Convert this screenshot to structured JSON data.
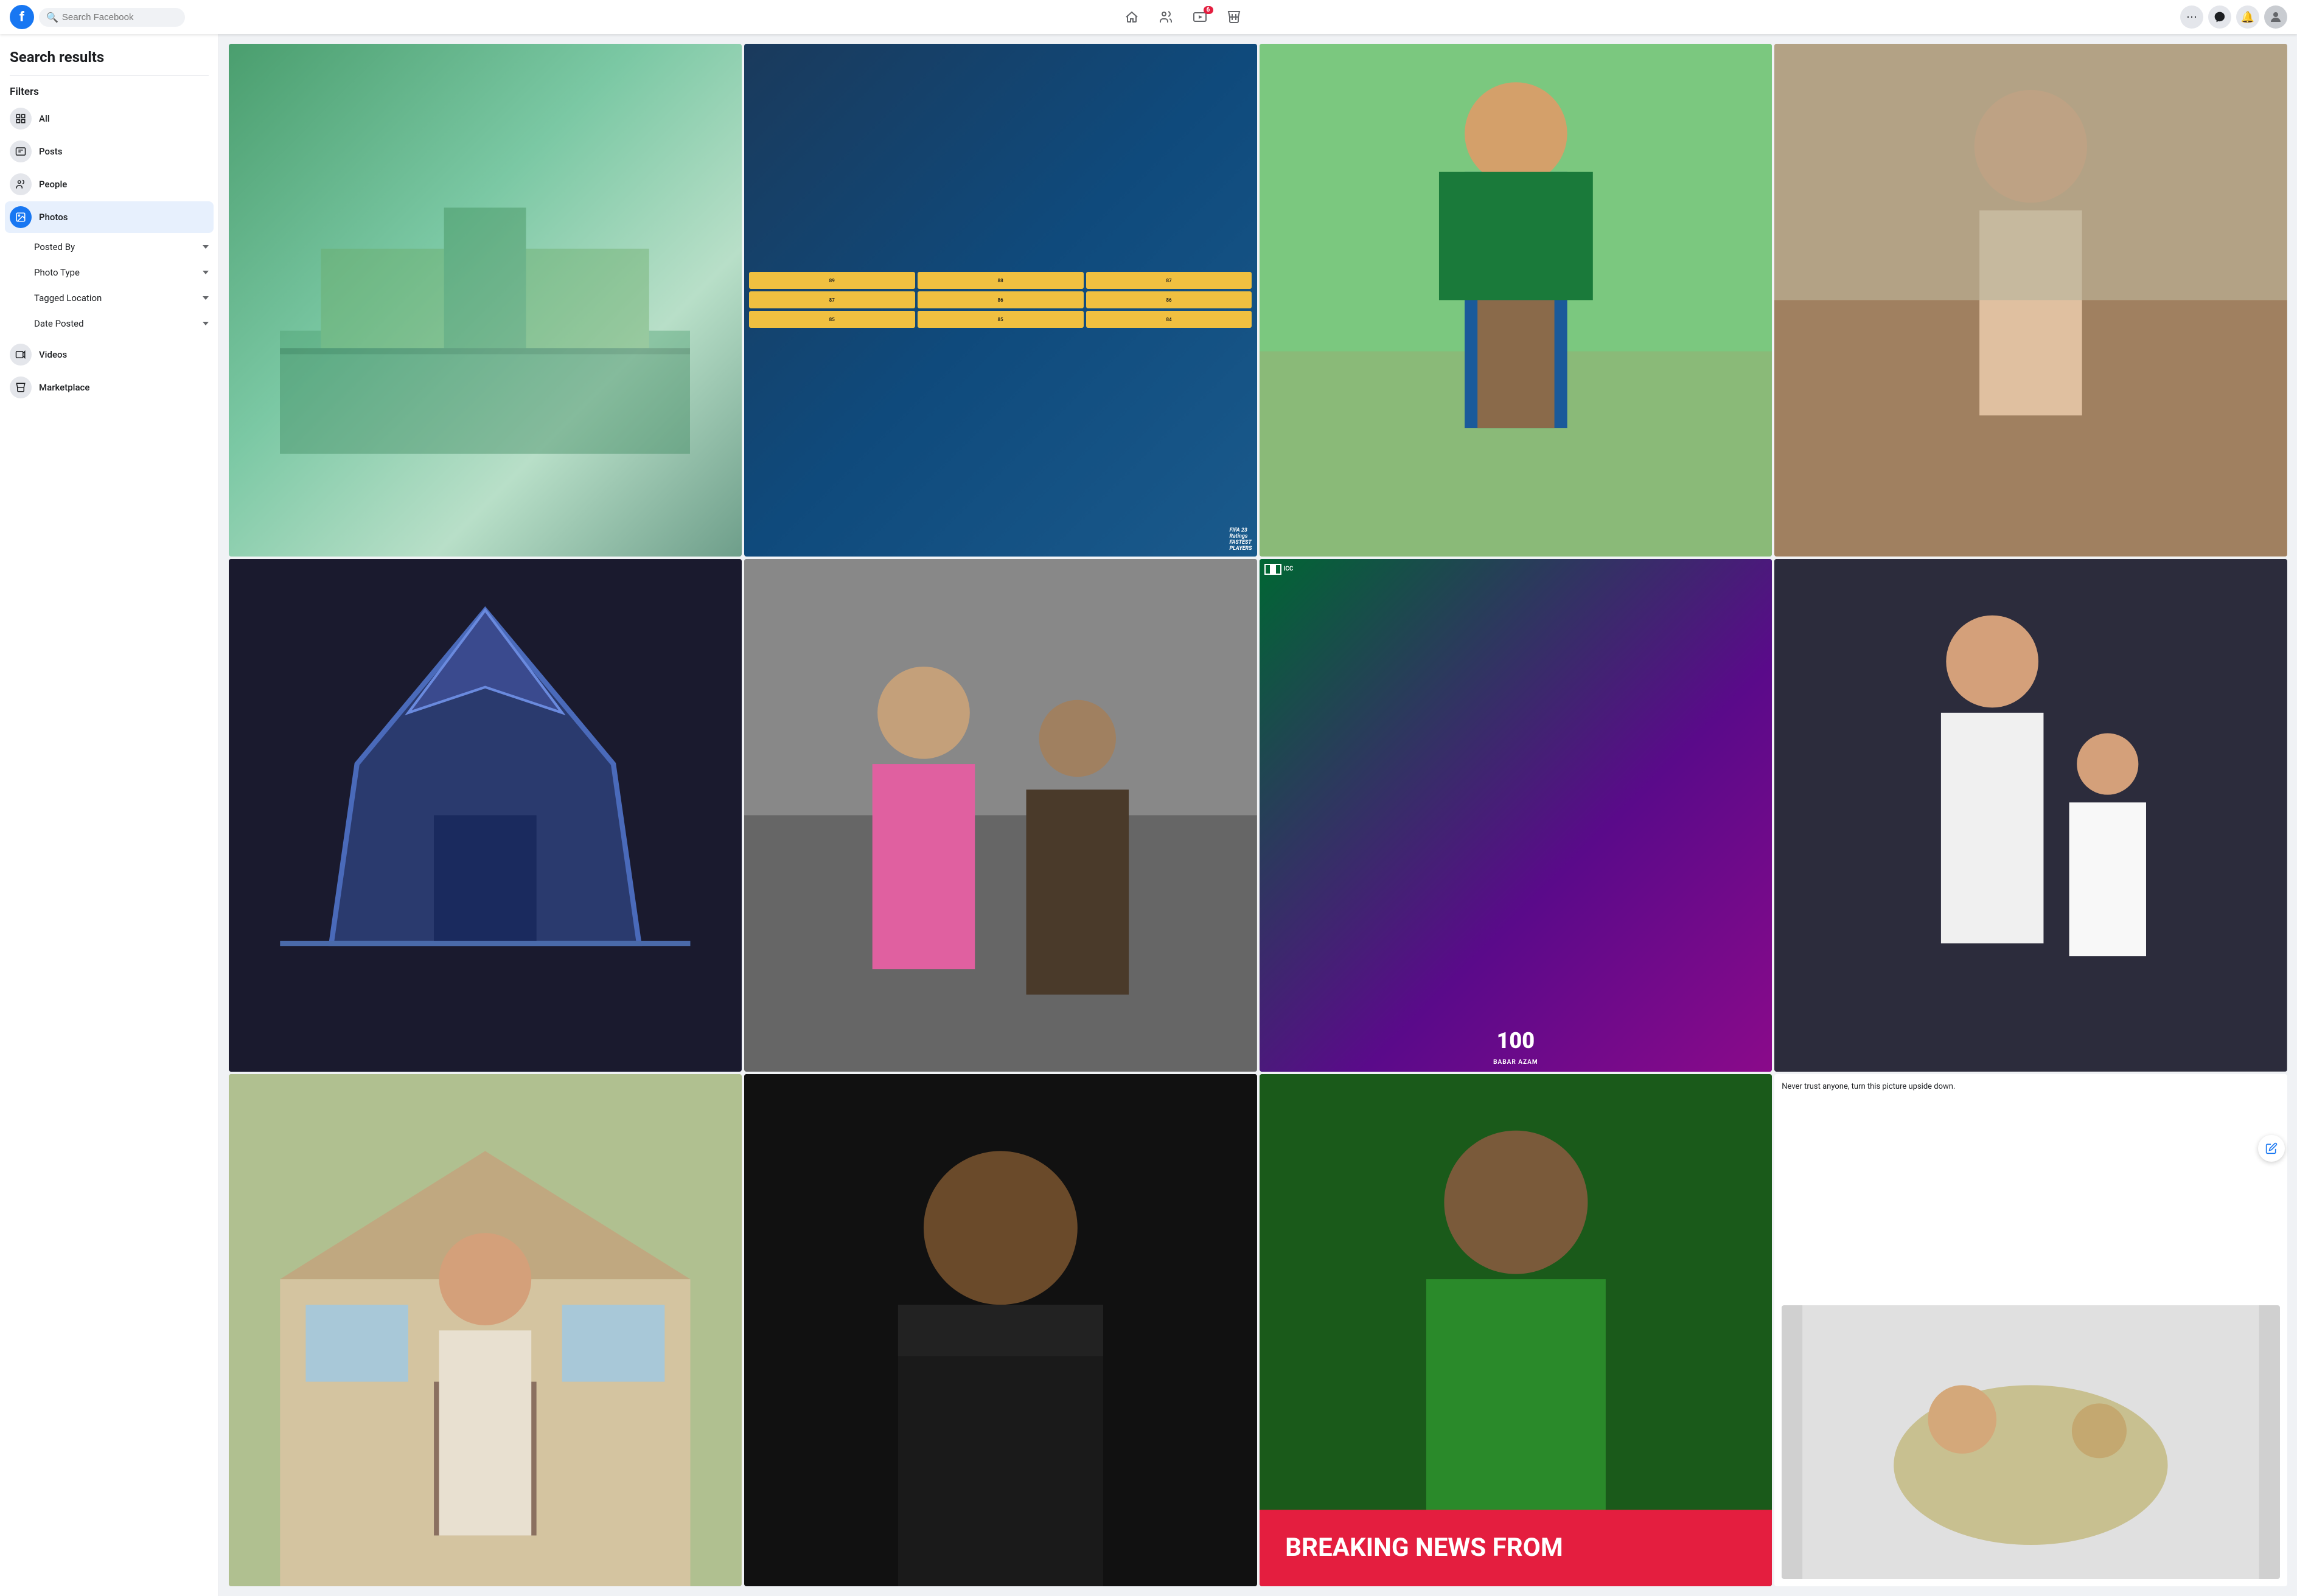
{
  "app": {
    "name": "Facebook",
    "logo_letter": "f"
  },
  "topnav": {
    "search_placeholder": "Search Facebook",
    "nav_icons": [
      {
        "name": "home",
        "label": "Home",
        "badge": null
      },
      {
        "name": "friends",
        "label": "Friends",
        "badge": null
      },
      {
        "name": "watch",
        "label": "Watch",
        "badge": "6"
      },
      {
        "name": "marketplace",
        "label": "Marketplace",
        "badge": null
      }
    ],
    "right_icons": [
      {
        "name": "grid-menu",
        "label": "Menu"
      },
      {
        "name": "messenger",
        "label": "Messenger"
      },
      {
        "name": "notifications",
        "label": "Notifications"
      },
      {
        "name": "account",
        "label": "Account"
      }
    ]
  },
  "sidebar": {
    "title": "Search results",
    "filters_label": "Filters",
    "filter_items": [
      {
        "id": "all",
        "label": "All",
        "active": false
      },
      {
        "id": "posts",
        "label": "Posts",
        "active": false
      },
      {
        "id": "people",
        "label": "People",
        "active": false
      },
      {
        "id": "photos",
        "label": "Photos",
        "active": true
      }
    ],
    "photo_filters": [
      {
        "id": "posted-by",
        "label": "Posted By"
      },
      {
        "id": "photo-type",
        "label": "Photo Type"
      },
      {
        "id": "tagged-location",
        "label": "Tagged Location"
      },
      {
        "id": "date-posted",
        "label": "Date Posted"
      }
    ],
    "other_filters": [
      {
        "id": "videos",
        "label": "Videos"
      },
      {
        "id": "marketplace",
        "label": "Marketplace"
      }
    ]
  },
  "main": {
    "photos": [
      {
        "id": 1,
        "theme": "landscape",
        "alt": "Aerial view of dam/river landscape"
      },
      {
        "id": 2,
        "theme": "fifa",
        "alt": "FIFA 23 Ratings Fastest Players cards"
      },
      {
        "id": 3,
        "theme": "outdoor-person",
        "alt": "Person standing outdoors in park"
      },
      {
        "id": 4,
        "theme": "warm-beach",
        "alt": "Woman in bikini at beach/rock"
      },
      {
        "id": 5,
        "theme": "anime",
        "alt": "Anime character dark mecha"
      },
      {
        "id": 6,
        "theme": "grey-talk",
        "alt": "Woman in pink dress on stage talk show"
      },
      {
        "id": 7,
        "theme": "cricket",
        "alt": "Babar Azam 100 Pakistan cricket ICC"
      },
      {
        "id": 8,
        "theme": "white-dress",
        "alt": "Woman in white dress with child"
      },
      {
        "id": 9,
        "theme": "house",
        "alt": "Man standing in front of house"
      },
      {
        "id": 10,
        "theme": "dark-person",
        "alt": "Person in dark jersey close up"
      },
      {
        "id": 11,
        "theme": "green-jersey",
        "alt": "Person in green jersey"
      },
      {
        "id": 12,
        "theme": "text-card",
        "alt": "Text: Never trust anyone turn this picture upside down",
        "text": "Never trust anyone, turn this picture upside down."
      }
    ],
    "cricket_text": "100",
    "cricket_name": "BABAR AZAM",
    "breaking_news_text": "BREAKING NEWS FROM"
  },
  "fab": {
    "label": "Edit"
  }
}
